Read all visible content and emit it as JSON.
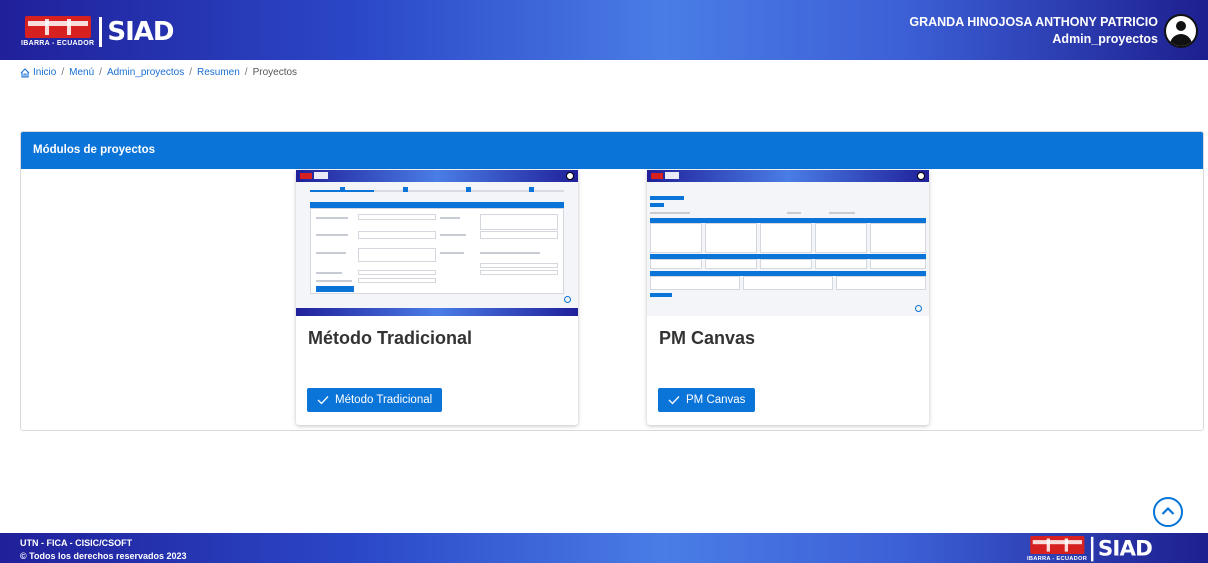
{
  "header": {
    "logo_mark": "UTN",
    "logo_subtitle": "IBARRA - ECUADOR",
    "logo_app": "SIAD",
    "user_name": "GRANDA HINOJOSA ANTHONY PATRICIO",
    "user_role": "Admin_proyectos"
  },
  "breadcrumb": {
    "items": [
      "Inicio",
      "Menú",
      "Admin_proyectos",
      "Resumen"
    ],
    "current": "Proyectos",
    "separator": "/"
  },
  "panel": {
    "title": "Módulos de proyectos",
    "cards": [
      {
        "title": "Método Tradicional",
        "button_label": "Método Tradicional"
      },
      {
        "title": "PM Canvas",
        "button_label": "PM Canvas"
      }
    ]
  },
  "footer": {
    "line1": "UTN - FICA - CISIC/CSOFT",
    "line2": "© Todos los derechos reservados 2023",
    "logo_subtitle": "IBARRA - ECUADOR",
    "logo_app": "SIAD"
  },
  "colors": {
    "primary": "#0a74d8",
    "header_gradient_dark": "#20209a",
    "header_gradient_light": "#4a7de6",
    "logo_red": "#d72020"
  },
  "icons": {
    "home": "home-icon",
    "check": "check-icon",
    "avatar": "user-avatar-icon",
    "scroll_top": "chevron-up-circle-icon"
  }
}
